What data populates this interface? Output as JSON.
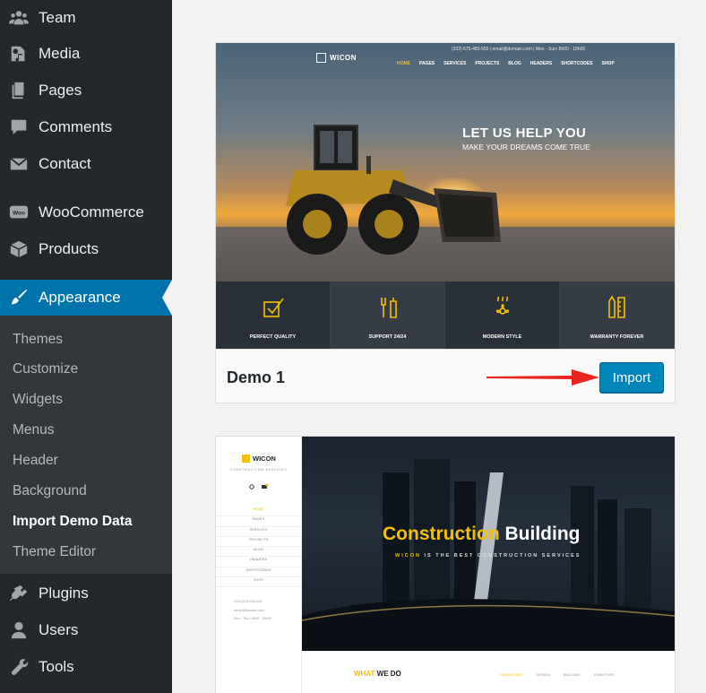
{
  "sidebar": {
    "items": [
      {
        "label": "Team",
        "icon": "groups-icon"
      },
      {
        "label": "Media",
        "icon": "media-icon"
      },
      {
        "label": "Pages",
        "icon": "pages-icon"
      },
      {
        "label": "Comments",
        "icon": "comment-icon"
      },
      {
        "label": "Contact",
        "icon": "mail-icon"
      },
      {
        "label": "WooCommerce",
        "icon": "woocommerce-icon"
      },
      {
        "label": "Products",
        "icon": "archive-box-icon"
      },
      {
        "label": "Appearance",
        "icon": "paintbrush-icon"
      },
      {
        "label": "Plugins",
        "icon": "plugin-icon"
      },
      {
        "label": "Users",
        "icon": "user-icon"
      },
      {
        "label": "Tools",
        "icon": "wrench-icon"
      }
    ],
    "submenu": [
      "Themes",
      "Customize",
      "Widgets",
      "Menus",
      "Header",
      "Background",
      "Import Demo Data",
      "Theme Editor"
    ],
    "current_submenu": "Import Demo Data",
    "colors": {
      "bg": "#23282d",
      "submenu_bg": "#32373c",
      "active": "#0073aa"
    }
  },
  "demos": [
    {
      "name": "Demo 1",
      "import_label": "Import",
      "preview": {
        "logo": "WICON",
        "topbar": "(322) 675-483-555   |   email@domain.com   |   Mon - Sun: 8h00 - 18h00",
        "nav": [
          "HOME",
          "PAGES",
          "SERVICES",
          "PROJECTS",
          "BLOG",
          "HEADERS",
          "SHORTCODES",
          "SHOP"
        ],
        "headline": "LET US HELP YOU",
        "subline": "MAKE YOUR DREAMS COME TRUE",
        "features": [
          "PERFECT QUALITY",
          "SUPPORT 24/24",
          "MODERN STYLE",
          "WARRANTY FOREVER"
        ]
      }
    },
    {
      "preview": {
        "logo": "WICON",
        "tagline": "CONSTRUCTION SERVICES",
        "menu": [
          "HOME",
          "PAGES",
          "SERVICES",
          "PROJECTS",
          "BLOG",
          "HEADERS",
          "SHORTCODES",
          "SHOP"
        ],
        "contact": [
          "(322) 675-483-555",
          "email@domain.com",
          "Mon - Sun: 8h00 - 18h00"
        ],
        "headline_accent": "Construction",
        "headline_rest": "Building",
        "subline_accent": "WICON",
        "subline": "IS THE BEST CONSTRUCTION SERVICES",
        "section_accent": "WHAT",
        "section_rest": "WE DO",
        "tabs": [
          "CONSULTANT",
          "DESIGN",
          "BUILDING",
          "FURNITURE"
        ]
      }
    }
  ],
  "colors": {
    "accent_yellow": "#f5c000",
    "import_button": "#0085ba",
    "arrow": "#e8261b"
  }
}
